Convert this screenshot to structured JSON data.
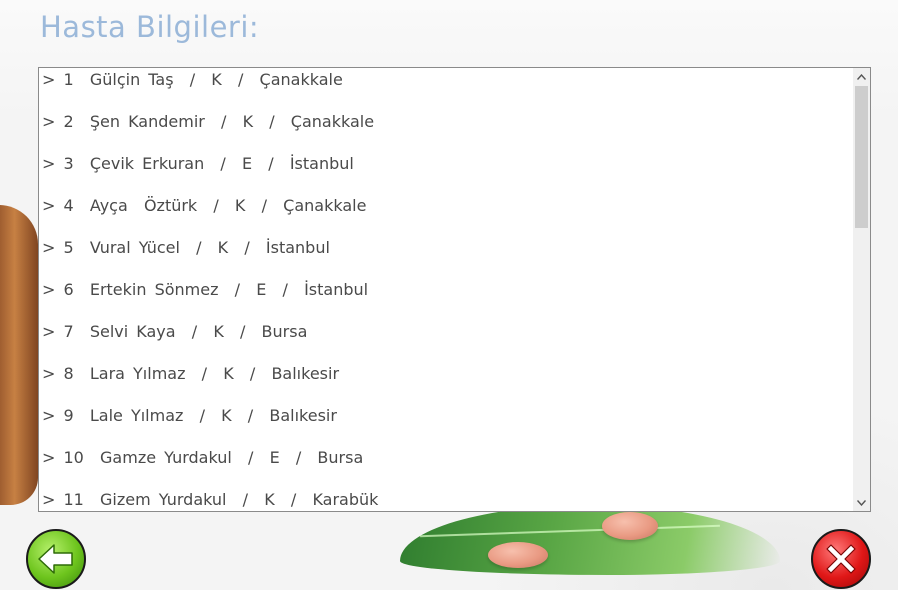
{
  "header": {
    "title": "Hasta Bilgileri:"
  },
  "patient_list": {
    "items": [
      {
        "label": "> 1  Gülçin Taş  /  K  /  Çanakkale"
      },
      {
        "label": "> 2  Şen Kandemir  /  K  /  Çanakkale"
      },
      {
        "label": "> 3  Çevik Erkuran  /  E  /  İstanbul"
      },
      {
        "label": "> 4  Ayça  Öztürk  /  K  /  Çanakkale"
      },
      {
        "label": "> 5  Vural Yücel  /  K  /  İstanbul"
      },
      {
        "label": "> 6  Ertekin Sönmez  /  E  /  İstanbul"
      },
      {
        "label": "> 7  Selvi Kaya  /  K  /  Bursa"
      },
      {
        "label": "> 8  Lara Yılmaz  /  K  /  Balıkesir"
      },
      {
        "label": "> 9  Lale Yılmaz  /  K  /  Balıkesir"
      },
      {
        "label": "> 10  Gamze Yurdakul  /  E  /  Bursa"
      },
      {
        "label": "> 11  Gizem Yurdakul  /  K  /  Karabük"
      }
    ]
  },
  "buttons": {
    "back_icon": "arrow-left-icon",
    "close_icon": "close-x-icon"
  },
  "colors": {
    "title": "#9cb9da",
    "back_button": "#6dc41d",
    "close_button": "#e01717",
    "list_text": "#4a4a4a"
  }
}
